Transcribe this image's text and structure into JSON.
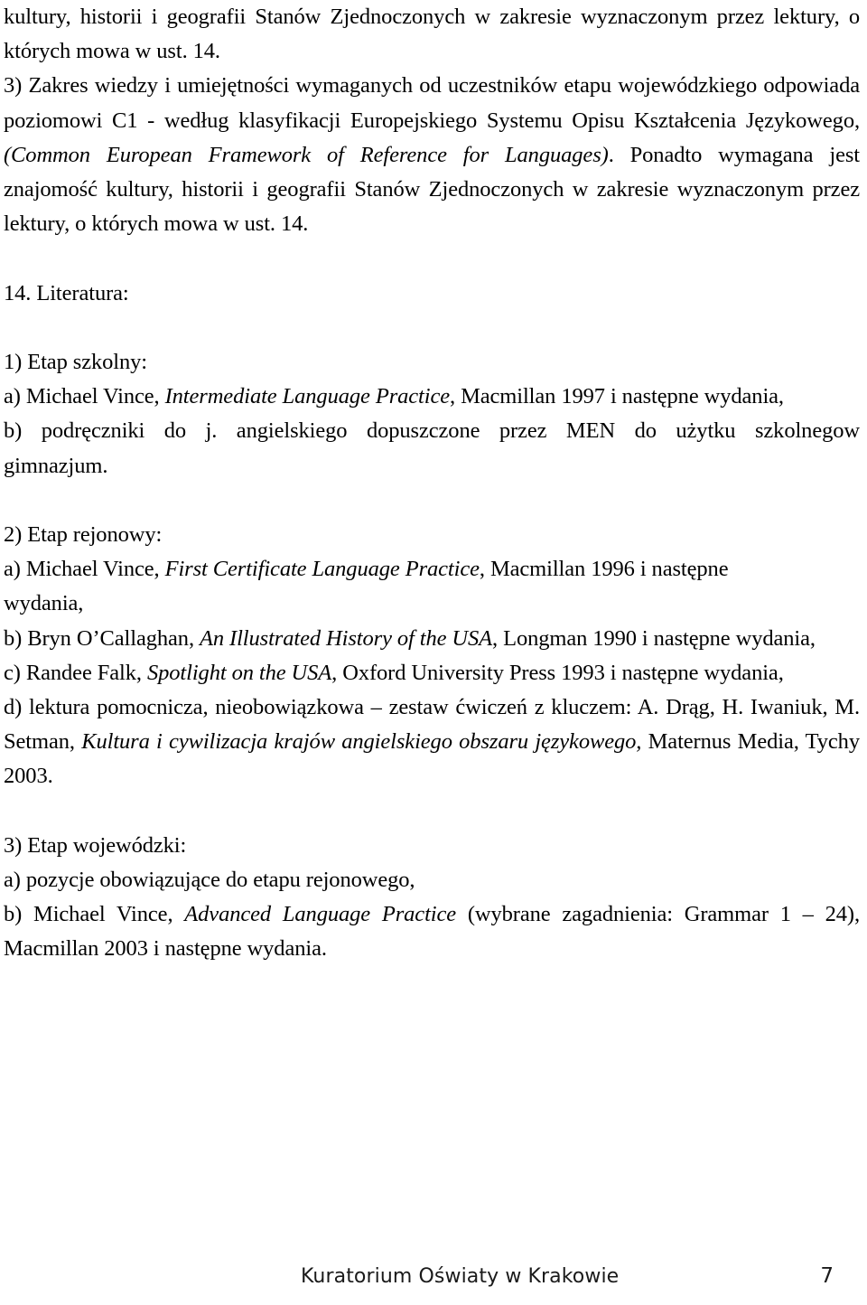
{
  "document": {
    "language": "pl",
    "page_number": "7",
    "footer_org": "Kuratorium Oświaty w Krakowie"
  },
  "body": {
    "continued_paragraph": {
      "line1": "kultury, historii i geografii Stanów Zjednoczonych w zakresie wyznaczonym przez lektury, o",
      "line2": "których mowa w ust. 14."
    },
    "point3": {
      "lead": "3) Zakres wiedzy i umiejętności wymaganych od uczestników etapu wojewódzkiego odpowiada poziomowi C1 - według klasyfikacji Europejskiego Systemu Opisu Kształcenia Językowego, ",
      "italic_title": "(Common European Framework of Reference for Languages)",
      "tail": ". Ponadto wymagana jest znajomość kultury, historii i geografii Stanów Zjednoczonych w zakresie wyznaczonym przez lektury, o których mowa w ust. 14."
    },
    "section_heading": "14. Literatura:",
    "stage1": {
      "heading": "1) Etap szkolny:",
      "item_a_pre": "a) Michael Vince, ",
      "item_a_title": "Intermediate Language Practice",
      "item_a_post": ", Macmillan 1997 i następne wydania,",
      "item_b_line1": "b) podręczniki do j. angielskiego dopuszczone przez MEN do użytku szkolnego",
      "item_b_tail": "w",
      "item_b_line2": "gimnazjum."
    },
    "stage2": {
      "heading": "2) Etap rejonowy:",
      "item_a_pre": "a) Michael Vince, ",
      "item_a_title": "First Certificate Language Practice",
      "item_a_post": ", Macmillan 1996 i następne",
      "item_a_line2": "wydania,",
      "item_b_pre": "b) Bryn O’Callaghan, ",
      "item_b_title": "An Illustrated History of the USA",
      "item_b_post": ", Longman 1990 i następne wydania,",
      "item_c_pre": "c) Randee Falk, ",
      "item_c_title": "Spotlight on the USA",
      "item_c_post": ", Oxford University Press 1993 i następne wydania,",
      "item_d_pre": "d) lektura pomocnicza, nieobowiązkowa – zestaw ćwiczeń z kluczem: A. Drąg, H. Iwaniuk, M. Setman, ",
      "item_d_title": "Kultura i cywilizacja krajów angielskiego obszaru językowego,",
      "item_d_post": " Maternus Media, Tychy 2003."
    },
    "stage3": {
      "heading": "3) Etap wojewódzki:",
      "item_a": "a) pozycje obowiązujące do etapu rejonowego,",
      "item_b_pre": "b) Michael Vince, ",
      "item_b_title": "Advanced Language Practice",
      "item_b_post": " (wybrane zagadnienia: Grammar 1 – 24), Macmillan 2003 i następne wydania."
    }
  }
}
